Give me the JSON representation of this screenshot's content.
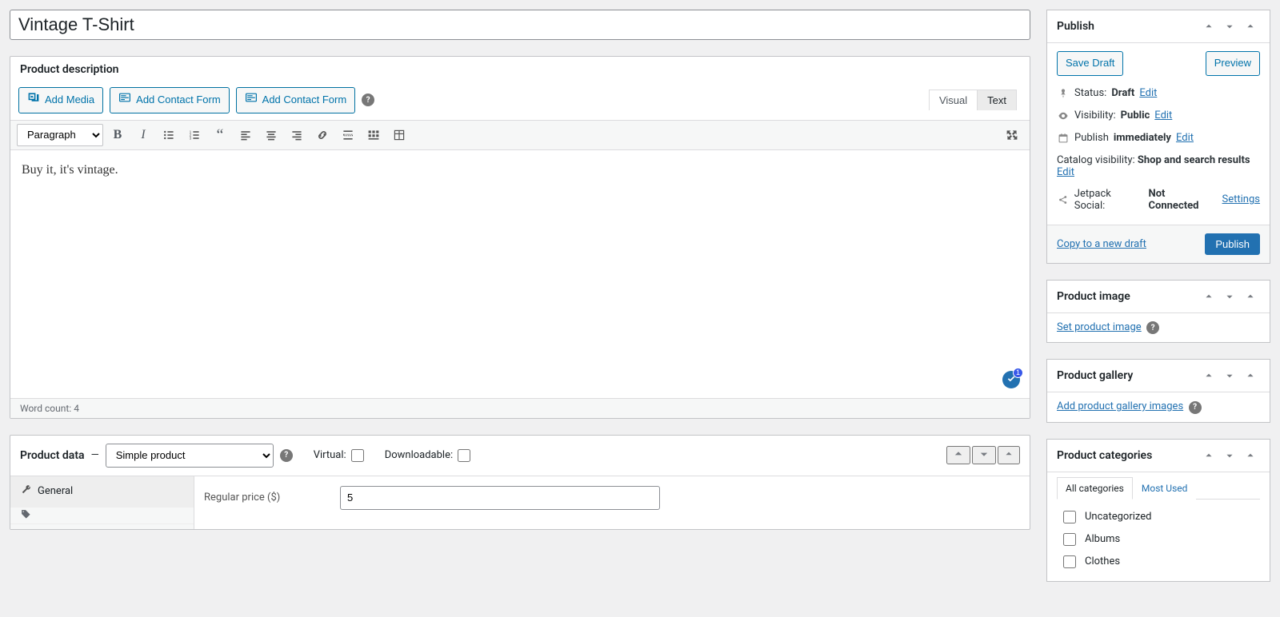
{
  "title": "Vintage T-Shirt",
  "description_box": {
    "heading": "Product description",
    "add_media": "Add Media",
    "add_contact_form": "Add Contact Form",
    "tabs": {
      "visual": "Visual",
      "text": "Text"
    },
    "format_select": "Paragraph",
    "content": "Buy it, it's vintage.",
    "word_count_label": "Word count: ",
    "word_count": "4",
    "badge_count": "1"
  },
  "product_data": {
    "heading": "Product data",
    "dash": "—",
    "type": "Simple product",
    "virtual_label": "Virtual:",
    "downloadable_label": "Downloadable:",
    "general_tab": "General",
    "regular_price_label": "Regular price ($)",
    "regular_price_value": "5"
  },
  "publish": {
    "heading": "Publish",
    "save_draft": "Save Draft",
    "preview": "Preview",
    "status_label": "Status: ",
    "status_value": "Draft",
    "visibility_label": "Visibility: ",
    "visibility_value": "Public",
    "publish_label": "Publish ",
    "publish_value": "immediately",
    "catalog_label": "Catalog visibility: ",
    "catalog_value": "Shop and search results",
    "jetpack_label": "Jetpack Social: ",
    "jetpack_value": "Not Connected",
    "edit": "Edit",
    "settings": "Settings",
    "copy_draft": "Copy to a new draft",
    "publish_btn": "Publish"
  },
  "product_image": {
    "heading": "Product image",
    "link": "Set product image"
  },
  "product_gallery": {
    "heading": "Product gallery",
    "link": "Add product gallery images"
  },
  "categories": {
    "heading": "Product categories",
    "tab_all": "All categories",
    "tab_most": "Most Used",
    "items": [
      "Uncategorized",
      "Albums",
      "Clothes"
    ]
  }
}
